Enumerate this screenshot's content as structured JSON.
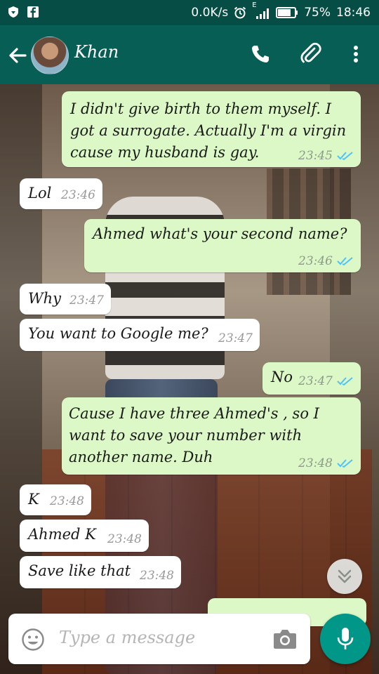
{
  "status_bar": {
    "speed": "0.0K/s",
    "network_label": "E",
    "battery": "75%",
    "time": "18:46"
  },
  "header": {
    "contact_name": "Khan"
  },
  "messages": [
    {
      "dir": "out",
      "text": "I didn't give birth to them myself. I got a surrogate. Actually I'm a virgin cause my husband is gay.",
      "time": "23:45",
      "read": true
    },
    {
      "dir": "in",
      "text": "Lol",
      "time": "23:46"
    },
    {
      "dir": "out",
      "text": "Ahmed what's your second name?",
      "time": "23:46",
      "read": true
    },
    {
      "dir": "in",
      "text": "Why",
      "time": "23:47"
    },
    {
      "dir": "in",
      "text": "You want to Google me?",
      "time": "23:47"
    },
    {
      "dir": "out",
      "text": "No",
      "time": "23:47",
      "read": true
    },
    {
      "dir": "out",
      "text": "Cause I have three Ahmed's , so I want to save your number with another name. Duh",
      "time": "23:48",
      "read": true
    },
    {
      "dir": "in",
      "text": "K",
      "time": "23:48"
    },
    {
      "dir": "in",
      "text": "Ahmed K",
      "time": "23:48"
    },
    {
      "dir": "in",
      "text": "Save like that",
      "time": "23:48"
    }
  ],
  "input": {
    "placeholder": "Type a message"
  },
  "colors": {
    "header": "#075e54",
    "status_bar": "#064e45",
    "outgoing_bubble": "#dcf8c6",
    "incoming_bubble": "#ffffff",
    "read_ticks": "#4fc3f7",
    "fab": "#009688"
  },
  "icons": {
    "back": "arrow-left-icon",
    "call": "phone-icon",
    "attach": "paperclip-icon",
    "menu": "more-vert-icon",
    "emoji": "emoji-icon",
    "camera": "camera-icon",
    "mic": "mic-icon",
    "scroll_down": "double-chevron-down-icon"
  }
}
